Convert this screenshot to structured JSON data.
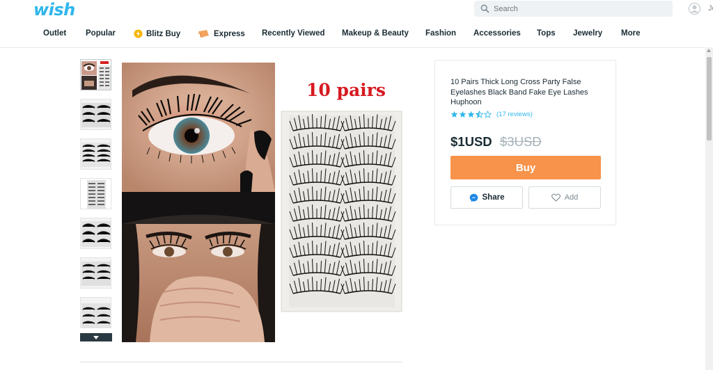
{
  "logo": "wish",
  "search": {
    "placeholder": "Search"
  },
  "user": {
    "name": "Je"
  },
  "nav": [
    {
      "label": "Outlet"
    },
    {
      "label": "Popular"
    },
    {
      "label": "Blitz Buy",
      "icon": "blitz-buy-icon"
    },
    {
      "label": "Express",
      "icon": "express-icon"
    },
    {
      "label": "Recently Viewed"
    },
    {
      "label": "Makeup & Beauty"
    },
    {
      "label": "Fashion"
    },
    {
      "label": "Accessories"
    },
    {
      "label": "Tops"
    },
    {
      "label": "Jewelry"
    },
    {
      "label": "More"
    }
  ],
  "gallery": {
    "thumbnail_count": 7,
    "main_image_caption": "10 pairs"
  },
  "product": {
    "title": "10 Pairs Thick Long Cross Party False Eyelashes Black Band Fake Eye Lashes Huphoon",
    "rating": 3.5,
    "reviews": "(17 reviews)",
    "price": "$1USD",
    "old_price": "$3USD",
    "buy_label": "Buy",
    "share_label": "Share",
    "add_label": "Add"
  },
  "colors": {
    "brand": "#2fb7ec",
    "buy": "#f7934a",
    "star": "#2fb7ec"
  }
}
